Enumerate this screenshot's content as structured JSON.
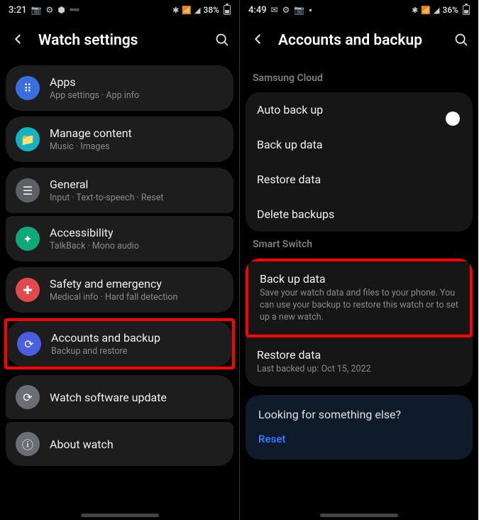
{
  "left": {
    "status": {
      "time": "3:21",
      "icons": [
        "📷",
        "⚙",
        "⬢",
        "➖"
      ],
      "right_icons": [
        "✱",
        "📶",
        "◢"
      ],
      "battery": "38%"
    },
    "title": "Watch settings",
    "items": [
      {
        "key": "apps",
        "label": "Apps",
        "sub": "App settings · App info",
        "icon_bg": "blue",
        "glyph": "⠿"
      },
      {
        "key": "manage-content",
        "label": "Manage content",
        "sub": "Music · Images",
        "icon_bg": "teal",
        "glyph": "📁"
      },
      {
        "key": "general",
        "label": "General",
        "sub": "Input · Text-to-speech · Reset",
        "icon_bg": "grey",
        "glyph": "☰"
      },
      {
        "key": "accessibility",
        "label": "Accessibility",
        "sub": "TalkBack · Mono audio",
        "icon_bg": "green",
        "glyph": "✦"
      },
      {
        "key": "safety",
        "label": "Safety and emergency",
        "sub": "Medical info · Hard fall detection",
        "icon_bg": "red",
        "glyph": "✚"
      },
      {
        "key": "accounts-backup",
        "label": "Accounts and backup",
        "sub": "Backup and restore",
        "icon_bg": "indigo",
        "glyph": "⟳",
        "highlight": true
      },
      {
        "key": "software-update",
        "label": "Watch software update",
        "sub": "",
        "icon_bg": "grey2",
        "glyph": "⟳"
      },
      {
        "key": "about",
        "label": "About watch",
        "sub": "",
        "icon_bg": "grey2",
        "glyph": "ⓘ"
      }
    ]
  },
  "right": {
    "status": {
      "time": "4:49",
      "icons": [
        "✉",
        "⚙",
        "📷",
        "▪"
      ],
      "right_icons": [
        "✱",
        "📶",
        "◢"
      ],
      "battery": "36%"
    },
    "title": "Accounts and backup",
    "sections": [
      {
        "heading": "Samsung Cloud",
        "rows": [
          {
            "key": "auto-backup",
            "label": "Auto back up",
            "toggle": true
          },
          {
            "key": "backup-data",
            "label": "Back up data"
          },
          {
            "key": "restore-data",
            "label": "Restore data"
          },
          {
            "key": "delete-backups",
            "label": "Delete backups"
          }
        ]
      },
      {
        "heading": "Smart Switch",
        "rows": [
          {
            "key": "ss-backup",
            "label": "Back up data",
            "sub": "Save your watch data and files to your phone. You can use your backup to restore this watch or to set up a new watch.",
            "highlight": true
          },
          {
            "key": "ss-restore",
            "label": "Restore data",
            "sub": "Last backed up: Oct 15, 2022"
          }
        ]
      }
    ],
    "tip": {
      "question": "Looking for something else?",
      "link": "Reset"
    }
  }
}
